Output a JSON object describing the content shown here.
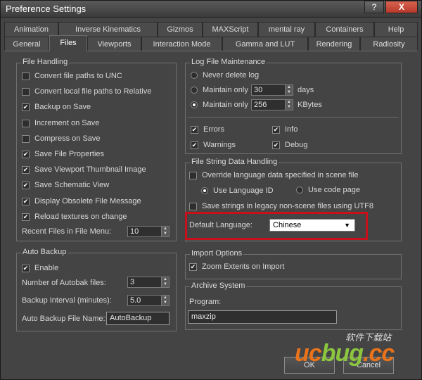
{
  "window": {
    "title": "Preference Settings",
    "help": "?",
    "close": "X"
  },
  "tabs_row1": [
    "Animation",
    "Inverse Kinematics",
    "Gizmos",
    "MAXScript",
    "mental ray",
    "Containers",
    "Help"
  ],
  "tabs_row2": [
    "General",
    "Files",
    "Viewports",
    "Interaction Mode",
    "Gamma and LUT",
    "Rendering",
    "Radiosity"
  ],
  "active_tab": "Files",
  "file_handling": {
    "title": "File Handling",
    "options": [
      {
        "label": "Convert file paths to UNC",
        "checked": false
      },
      {
        "label": "Convert local file paths to Relative",
        "checked": false
      },
      {
        "label": "Backup on Save",
        "checked": true
      },
      {
        "label": "Increment on Save",
        "checked": false
      },
      {
        "label": "Compress on Save",
        "checked": false
      },
      {
        "label": "Save File Properties",
        "checked": true
      },
      {
        "label": "Save Viewport Thumbnail Image",
        "checked": true
      },
      {
        "label": "Save Schematic View",
        "checked": true
      },
      {
        "label": "Display Obsolete File Message",
        "checked": true
      },
      {
        "label": "Reload textures on change",
        "checked": true
      }
    ],
    "recent_label": "Recent Files in File Menu:",
    "recent_value": "10"
  },
  "auto_backup": {
    "title": "Auto Backup",
    "enable_label": "Enable",
    "enable_checked": true,
    "count_label": "Number of Autobak files:",
    "count_value": "3",
    "interval_label": "Backup Interval (minutes):",
    "interval_value": "5.0",
    "name_label": "Auto Backup File Name:",
    "name_value": "AutoBackup"
  },
  "log_maintenance": {
    "title": "Log File Maintenance",
    "never_label": "Never delete log",
    "days_prefix": "Maintain only",
    "days_value": "30",
    "days_unit": "days",
    "kb_prefix": "Maintain only",
    "kb_value": "256",
    "kb_unit": "KBytes",
    "selected": "kbytes",
    "errors_label": "Errors",
    "info_label": "Info",
    "warnings_label": "Warnings",
    "debug_label": "Debug"
  },
  "string_handling": {
    "title": "File String Data Handling",
    "override_label": "Override language data specified in scene file",
    "use_lang_label": "Use Language ID",
    "use_code_label": "Use code page",
    "legacy_label": "Save strings in legacy non-scene files using UTF8",
    "default_lang_label": "Default Language:",
    "default_lang_value": "Chinese",
    "caret": "▼"
  },
  "import_options": {
    "title": "Import Options",
    "zoom_label": "Zoom Extents on Import",
    "zoom_checked": true
  },
  "archive_system": {
    "title": "Archive System",
    "program_label": "Program:",
    "program_value": "maxzip"
  },
  "footer": {
    "ok": "OK",
    "cancel": "Cancel"
  },
  "watermark": {
    "brand_u": "uc",
    "brand_b": "bug",
    "brand_cc": ".cc",
    "tagline": "软件下载站"
  },
  "checkmark": "✔",
  "spin_up": "▲",
  "spin_down": "▼"
}
